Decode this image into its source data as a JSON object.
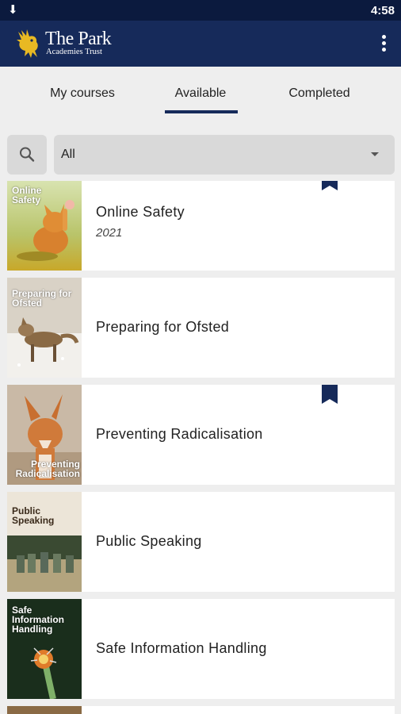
{
  "status_bar": {
    "download_glyph": "⬇",
    "time": "4:58"
  },
  "app_bar": {
    "brand_title": "The Park",
    "brand_subtitle": "Academies Trust",
    "logo_icon": "griffin-logo-icon",
    "menu_icon": "more-vert-icon"
  },
  "tabs": [
    {
      "label": "My courses",
      "selected": false
    },
    {
      "label": "Available",
      "selected": true
    },
    {
      "label": "Completed",
      "selected": false
    }
  ],
  "filter": {
    "search_icon": "search-icon",
    "selected": "All"
  },
  "courses": [
    {
      "title": "Online Safety",
      "year": "2021",
      "thumb_label": "Online Safety",
      "bookmarked": true
    },
    {
      "title": "Preparing for Ofsted",
      "thumb_label": "Preparing for Ofsted",
      "bookmarked": false
    },
    {
      "title": "Preventing Radicalisation",
      "thumb_label": "Preventing Radicalisation",
      "bookmarked": true
    },
    {
      "title": "Public Speaking",
      "thumb_label": "Public Speaking",
      "bookmarked": false
    },
    {
      "title": "Safe Information Handling",
      "thumb_label": "Safe Information Handling",
      "bookmarked": false
    }
  ],
  "colors": {
    "status_bar": "#0b1a3e",
    "app_bar": "#162a5a",
    "accent": "#162a5a",
    "background": "#eeeeee",
    "logo_gold": "#e8b923"
  }
}
